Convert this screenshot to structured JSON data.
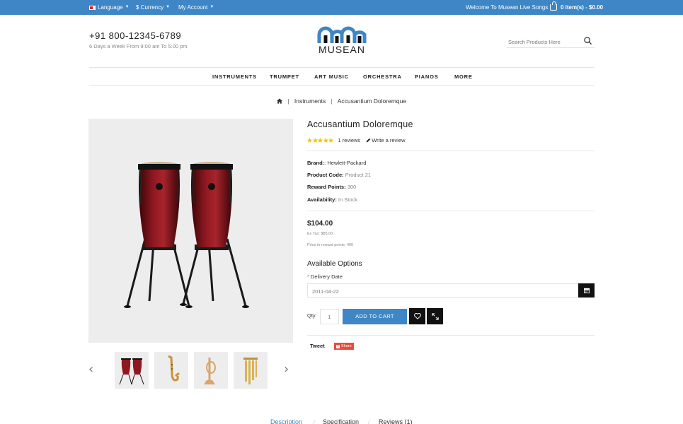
{
  "topbar": {
    "language": "Language",
    "currency": "$ Currency",
    "account": "My Account",
    "welcome": "Welcome To Musean Live Songs",
    "cart": "0 item(s) - $0.00"
  },
  "header": {
    "phone": "+91 800-12345-6789",
    "hours": "6 Days a Week From 9:00 am To 5:00 pm",
    "logo_text": "MUSEAN",
    "search_placeholder": "Search Products Here"
  },
  "nav": {
    "items": [
      "INSTRUMENTS",
      "TRUMPET",
      "ART MUSIC",
      "ORCHESTRA",
      "PIANOS",
      "MORE"
    ]
  },
  "breadcrumb": {
    "items": [
      "Instruments",
      "Accusantium Doloremque"
    ]
  },
  "gallery": {
    "thumbnails": [
      "conga-drums",
      "saxophone",
      "trumpet",
      "wind-chimes"
    ]
  },
  "product": {
    "title": "Accusantium Doloremque",
    "rating": 5,
    "reviews_count": "1 reviews",
    "write_review": "Write a review",
    "brand_label": "Brand:",
    "brand_value": ": Hewlett-Packard",
    "code_label": "Product Code:",
    "code_value": "Product 21",
    "reward_label": "Reward Points:",
    "reward_value": "300",
    "availability_label": "Availability:",
    "availability_value": "In Stock",
    "price": "$104.00",
    "ex_tax": "Ex Tax: $85.00",
    "reward_price": "Price in reward points: 400",
    "options_title": "Available Options",
    "delivery_label": "Delivery Date",
    "delivery_value": "2011-04-22",
    "qty_label": "Qty",
    "qty_value": "1",
    "add_to_cart": "ADD TO CART",
    "tweet": "Tweet",
    "share": "Share"
  },
  "tabs": {
    "items": [
      "Description",
      "Specification",
      "Reviews (1)"
    ]
  },
  "colors": {
    "accent": "#3e86c5",
    "dark_button": "#111111",
    "star": "#f5c400",
    "share": "#e74c3c"
  }
}
